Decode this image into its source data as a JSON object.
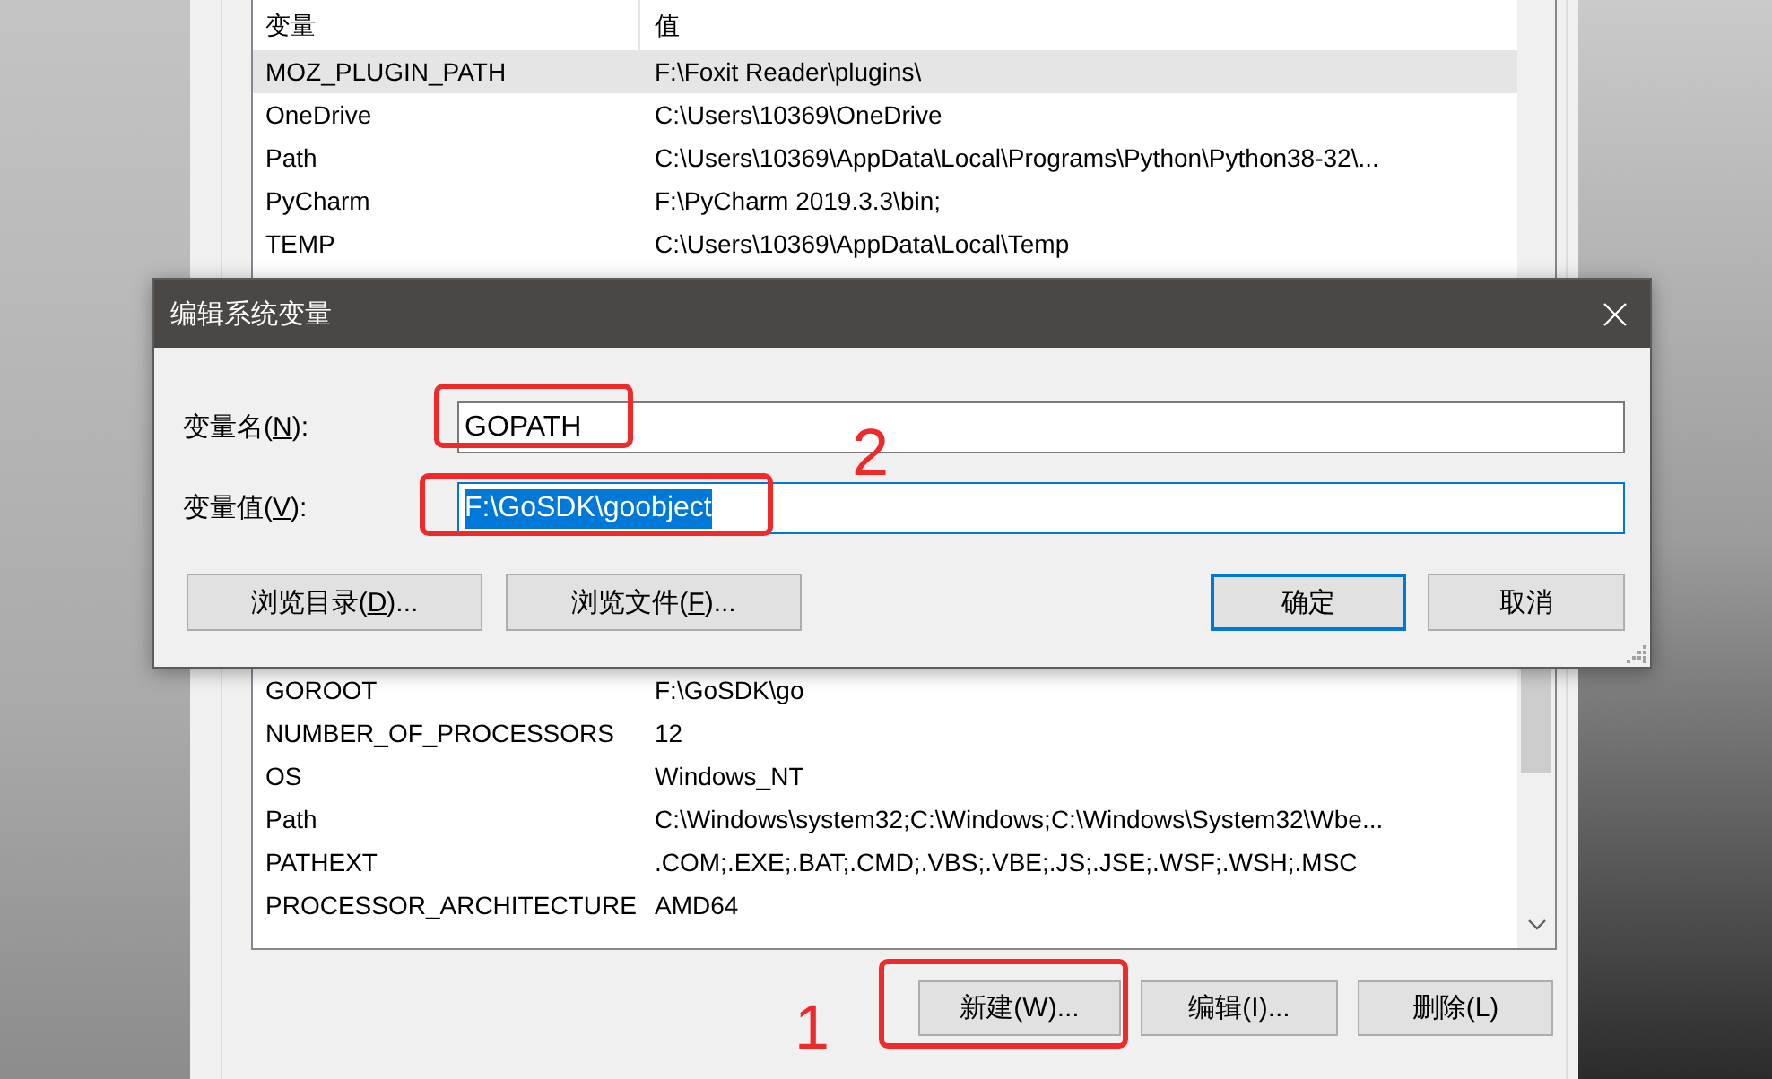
{
  "settings_window": {
    "user_variables": {
      "columns": [
        "变量",
        "值"
      ],
      "rows": [
        {
          "name": "MOZ_PLUGIN_PATH",
          "value": "F:\\Foxit Reader\\plugins\\",
          "selected": true
        },
        {
          "name": "OneDrive",
          "value": "C:\\Users\\10369\\OneDrive",
          "selected": false
        },
        {
          "name": "Path",
          "value": "C:\\Users\\10369\\AppData\\Local\\Programs\\Python\\Python38-32\\...",
          "selected": false
        },
        {
          "name": "PyCharm",
          "value": "F:\\PyCharm 2019.3.3\\bin;",
          "selected": false
        },
        {
          "name": "TEMP",
          "value": "C:\\Users\\10369\\AppData\\Local\\Temp",
          "selected": false
        }
      ]
    },
    "system_variables": {
      "rows": [
        {
          "name": "GOROOT",
          "value": "F:\\GoSDK\\go",
          "selected": false
        },
        {
          "name": "NUMBER_OF_PROCESSORS",
          "value": "12",
          "selected": false
        },
        {
          "name": "OS",
          "value": "Windows_NT",
          "selected": false
        },
        {
          "name": "Path",
          "value": "C:\\Windows\\system32;C:\\Windows;C:\\Windows\\System32\\Wbe...",
          "selected": false
        },
        {
          "name": "PATHEXT",
          "value": ".COM;.EXE;.BAT;.CMD;.VBS;.VBE;.JS;.JSE;.WSF;.WSH;.MSC",
          "selected": false
        },
        {
          "name": "PROCESSOR_ARCHITECTURE",
          "value": "AMD64",
          "selected": false
        }
      ]
    },
    "buttons": [
      {
        "label": "新建(W)...",
        "annotation_box": true,
        "step_number": "1"
      },
      {
        "label": "编辑(I)...",
        "annotation_box": false
      },
      {
        "label": "删除(L)",
        "annotation_box": false
      }
    ]
  },
  "dialog": {
    "title": "编辑系统变量",
    "fields": [
      {
        "label": {
          "before": "变量名(",
          "access_key": "N",
          "after": "):"
        },
        "value": "GOPATH",
        "focused": false,
        "text_selected": false,
        "annotation_box": true
      },
      {
        "label": {
          "before": "变量值(",
          "access_key": "V",
          "after": "):"
        },
        "value": "F:\\GoSDK\\goobject",
        "focused": true,
        "text_selected": true,
        "annotation_box": true,
        "step_number": "2"
      }
    ],
    "browse_buttons": [
      {
        "label": {
          "before": "浏览目录(",
          "access_key": "D",
          "after": ")..."
        },
        "default": false
      },
      {
        "label": {
          "before": "浏览文件(",
          "access_key": "F",
          "after": ")..."
        },
        "default": false
      }
    ],
    "action_buttons": [
      {
        "label": {
          "before": "确定"
        },
        "default": true
      },
      {
        "label": {
          "before": "取消"
        },
        "default": false
      }
    ]
  }
}
